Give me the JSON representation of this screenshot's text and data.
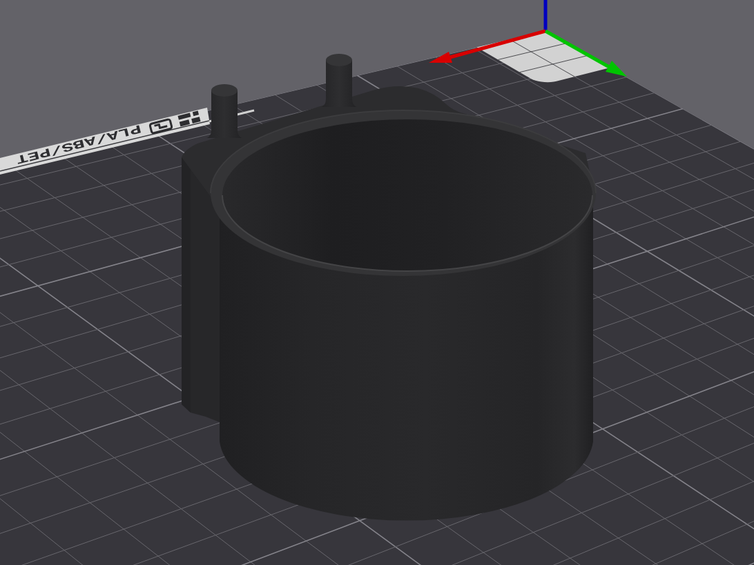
{
  "viewport": {
    "bed_label": "PLA/ABS/PET"
  }
}
